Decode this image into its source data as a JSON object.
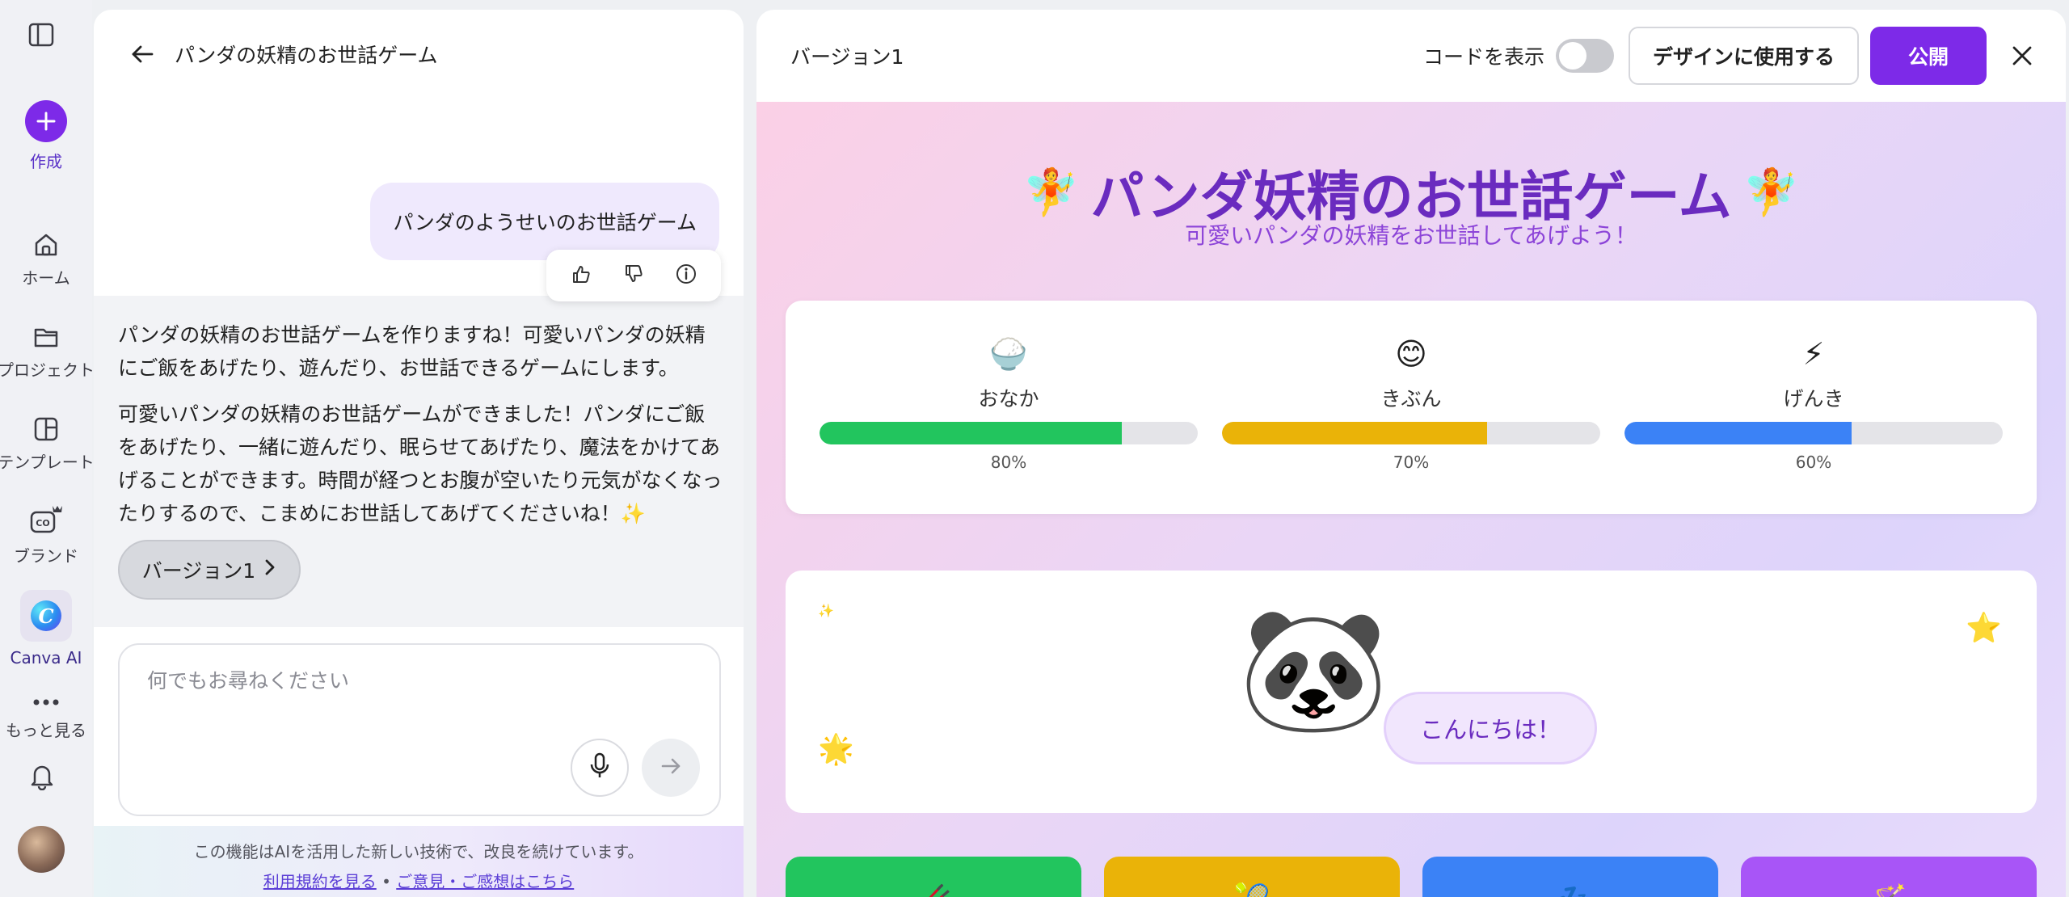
{
  "rail": {
    "create_label": "作成",
    "items": [
      {
        "label": "ホーム",
        "icon": "home-icon"
      },
      {
        "label": "プロジェクト",
        "icon": "folder-icon"
      },
      {
        "label": "テンプレート",
        "icon": "template-icon"
      },
      {
        "label": "ブランド",
        "icon": "brand-icon"
      },
      {
        "label": "Canva AI",
        "icon": "canva-ai-icon"
      },
      {
        "label": "もっと見る",
        "icon": "more-icon"
      }
    ],
    "canva_ai_logo_letter": "C"
  },
  "chat": {
    "title": "パンダの妖精のお世話ゲーム",
    "user_message": "パンダのようせいのお世話ゲーム",
    "ai_paragraphs": [
      "パンダの妖精のお世話ゲームを作りますね！可愛いパンダの妖精にご飯をあげたり、遊んだり、お世話できるゲームにします。",
      "可愛いパンダの妖精のお世話ゲームができました！パンダにご飯をあげたり、一緒に遊んだり、眠らせてあげたり、魔法をかけてあげることができます。時間が経つとお腹が空いたり元気がなくなったりするので、こまめにお世話してあげてくださいね！✨"
    ],
    "version_button": "バージョン1",
    "input_placeholder": "何でもお尋ねください",
    "disclaimer": "この機能はAIを活用した新しい技術で、改良を続けています。",
    "terms_link": "利用規約を見る",
    "separator": "•",
    "feedback_link": "ご意見・ご感想はこちら"
  },
  "preview": {
    "version_label": "バージョン1",
    "show_code_label": "コードを表示",
    "show_code_on": false,
    "use_in_design": "デザインに使用する",
    "publish": "公開",
    "accent_color": "#7d2ae8"
  },
  "game": {
    "title_emoji_left": "🧚",
    "title": "パンダ妖精のお世話ゲーム",
    "title_emoji_right": "🧚",
    "subtitle": "可愛いパンダの妖精をお世話してあげよう！",
    "stats": [
      {
        "emoji": "🍚",
        "label": "おなか",
        "value": 80,
        "pct": "80%",
        "color": "#22c55e"
      },
      {
        "emoji": "😊",
        "label": "きぶん",
        "value": 70,
        "pct": "70%",
        "color": "#eab308"
      },
      {
        "emoji": "⚡",
        "label": "げんき",
        "value": 60,
        "pct": "60%",
        "color": "#3b82f6"
      }
    ],
    "panda_emoji": "🐼",
    "greeting": "こんにちは！",
    "sparkles": [
      "✨",
      "⭐",
      "🌟"
    ],
    "actions": [
      {
        "emoji": "🥢",
        "color": "#22c55e"
      },
      {
        "emoji": "🎾",
        "color": "#eab308"
      },
      {
        "emoji": "💤",
        "color": "#3b82f6"
      },
      {
        "emoji": "🪄",
        "color": "#a855f7"
      }
    ]
  }
}
